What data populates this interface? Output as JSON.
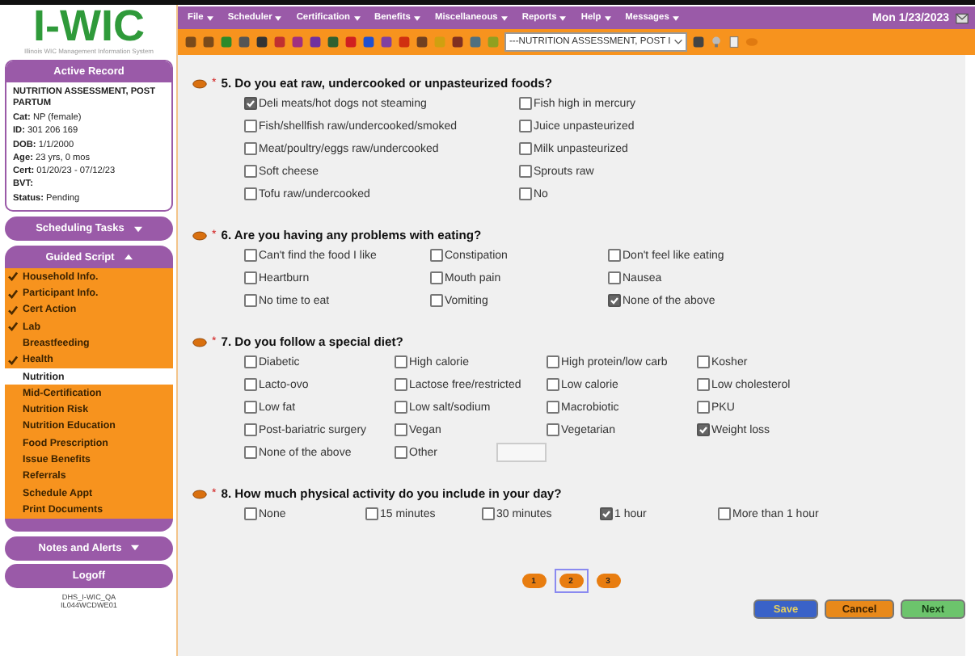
{
  "logo": {
    "title": "I-WIC",
    "subtitle": "Illinois WIC Management Information System"
  },
  "menu": [
    "File",
    "Scheduler",
    "Certification",
    "Benefits",
    "Miscellaneous",
    "Reports",
    "Help",
    "Messages"
  ],
  "date": "Mon 1/23/2023",
  "toolbar": {
    "dropdown": "---NUTRITION ASSESSMENT, POST I"
  },
  "active_record": {
    "title": "Active Record",
    "heading": "NUTRITION ASSESSMENT, POST PARTUM",
    "fields": [
      "**Cat:** NP (female)",
      "**ID:** 301 206 169",
      "**DOB:** 1/1/2000",
      "**Age:** 23 yrs, 0 mos",
      "**Cert:** 01/20/23 - 07/12/23",
      "**BVT:**",
      "**Status:** Pending"
    ]
  },
  "scheduling_tasks": {
    "label": "Scheduling Tasks",
    "expanded": false
  },
  "guided_script": {
    "label": "Guided Script",
    "expanded": true,
    "items": [
      {
        "label": "Household Info.",
        "checked": true,
        "selected": false
      },
      {
        "label": "Participant Info.",
        "checked": true,
        "selected": false
      },
      {
        "label": "Cert Action",
        "checked": true,
        "selected": false
      },
      {
        "label": "Lab",
        "checked": true,
        "selected": false
      },
      {
        "label": "Breastfeeding",
        "checked": false,
        "selected": false
      },
      {
        "label": "Health",
        "checked": true,
        "selected": false
      },
      {
        "label": "Nutrition",
        "checked": false,
        "selected": true
      },
      {
        "label": "Mid-Certification",
        "checked": false,
        "selected": false
      },
      {
        "label": "Nutrition Risk",
        "checked": false,
        "selected": false
      },
      {
        "label": "Nutrition Education",
        "checked": false,
        "selected": false
      },
      {
        "label": "Food Prescription",
        "checked": false,
        "selected": false
      },
      {
        "label": "Issue Benefits",
        "checked": false,
        "selected": false
      },
      {
        "label": "Referrals",
        "checked": false,
        "selected": false
      },
      {
        "label": "Schedule Appt",
        "checked": false,
        "selected": false
      },
      {
        "label": "Print Documents",
        "checked": false,
        "selected": false
      }
    ]
  },
  "notes_and_alerts": {
    "label": "Notes and Alerts",
    "expanded": false
  },
  "logoff": "Logoff",
  "footer": [
    "DHS_I-WIC_QA",
    "IL044WCDWE01"
  ],
  "questions": [
    {
      "mark": "*",
      "text": "5. Do you eat raw, undercooked or unpasteurized foods?",
      "options": [
        {
          "label": "Deli meats/hot dogs not steaming",
          "checked": true
        },
        {
          "label": "Fish high in mercury",
          "checked": false
        },
        {
          "label": "Fish/shellfish raw/undercooked/smoked",
          "checked": false
        },
        {
          "label": "Juice unpasteurized",
          "checked": false
        },
        {
          "label": "Meat/poultry/eggs raw/undercooked",
          "checked": false
        },
        {
          "label": "Milk unpasteurized",
          "checked": false
        },
        {
          "label": "Soft cheese",
          "checked": false
        },
        {
          "label": "Sprouts raw",
          "checked": false
        },
        {
          "label": "Tofu raw/undercooked",
          "checked": false
        },
        {
          "label": "No",
          "checked": false
        }
      ]
    },
    {
      "mark": "*",
      "text": "6. Are you having any problems with eating?",
      "options": [
        {
          "label": "Can't find the food I like",
          "checked": false
        },
        {
          "label": "Constipation",
          "checked": false
        },
        {
          "label": "Don't feel like eating",
          "checked": false
        },
        {
          "label": "Heartburn",
          "checked": false
        },
        {
          "label": "Mouth pain",
          "checked": false
        },
        {
          "label": "Nausea",
          "checked": false
        },
        {
          "label": "No time to eat",
          "checked": false
        },
        {
          "label": "Vomiting",
          "checked": false
        },
        {
          "label": "None of the above",
          "checked": true
        }
      ]
    },
    {
      "mark": "*",
      "text": "7. Do you follow a special diet?",
      "options": [
        {
          "label": "Diabetic",
          "checked": false
        },
        {
          "label": "High calorie",
          "checked": false
        },
        {
          "label": "High protein/low carb",
          "checked": false
        },
        {
          "label": "Kosher",
          "checked": false
        },
        {
          "label": "Lacto-ovo",
          "checked": false
        },
        {
          "label": "Lactose free/restricted",
          "checked": false
        },
        {
          "label": "Low calorie",
          "checked": false
        },
        {
          "label": "Low cholesterol",
          "checked": false
        },
        {
          "label": "Low fat",
          "checked": false
        },
        {
          "label": "Low salt/sodium",
          "checked": false
        },
        {
          "label": "Macrobiotic",
          "checked": false
        },
        {
          "label": "PKU",
          "checked": false
        },
        {
          "label": "Post-bariatric surgery",
          "checked": false
        },
        {
          "label": "Vegan",
          "checked": false
        },
        {
          "label": "Vegetarian",
          "checked": false
        },
        {
          "label": "Weight loss",
          "checked": true
        },
        {
          "label": "None of the above",
          "checked": false
        },
        {
          "label": "Other",
          "checked": false,
          "kind": "with-field"
        }
      ]
    },
    {
      "mark": "*",
      "text": "8. How much physical activity do you include in your day?",
      "options": [
        {
          "label": "None",
          "checked": false
        },
        {
          "label": "15 minutes",
          "checked": false
        },
        {
          "label": "30 minutes",
          "checked": false
        },
        {
          "label": "1 hour",
          "checked": true
        },
        {
          "label": "More than 1 hour",
          "checked": false
        }
      ]
    }
  ],
  "pages": [
    {
      "label": "1",
      "selected": false
    },
    {
      "label": "2",
      "selected": true
    },
    {
      "label": "3",
      "selected": false
    }
  ],
  "buttons": [
    {
      "label": "Save",
      "kind": "save"
    },
    {
      "label": "Cancel",
      "kind": "cancel"
    },
    {
      "label": "Next",
      "kind": "next"
    }
  ]
}
